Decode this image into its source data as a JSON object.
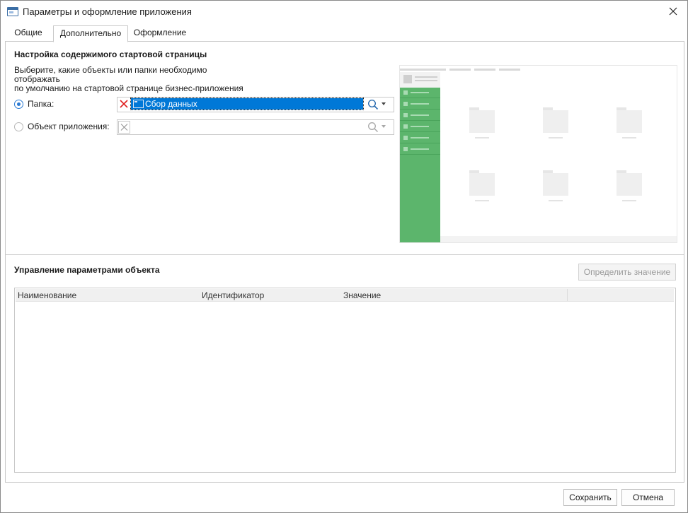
{
  "window": {
    "title": "Параметры и оформление приложения"
  },
  "tabs": [
    {
      "label": "Общие",
      "active": false
    },
    {
      "label": "Дополнительно",
      "active": true
    },
    {
      "label": "Оформление",
      "active": false
    }
  ],
  "start_page": {
    "title": "Настройка содержимого стартовой страницы",
    "hint_line1": "Выберите, какие объекты или папки необходимо отображать",
    "hint_line2": "по умолчанию на стартовой странице бизнес-приложения",
    "folder_option": {
      "label": "Папка:",
      "selected": true,
      "value": "Сбор данных"
    },
    "object_option": {
      "label": "Объект приложения:",
      "selected": false,
      "value": ""
    }
  },
  "params": {
    "title": "Управление параметрами объекта",
    "define_button": "Определить значение",
    "columns": [
      "Наименование",
      "Идентификатор",
      "Значение"
    ],
    "rows": []
  },
  "footer": {
    "save": "Сохранить",
    "cancel": "Отмена"
  },
  "colors": {
    "accent": "#0078d7",
    "preview_sidebar": "#5cb56c"
  }
}
